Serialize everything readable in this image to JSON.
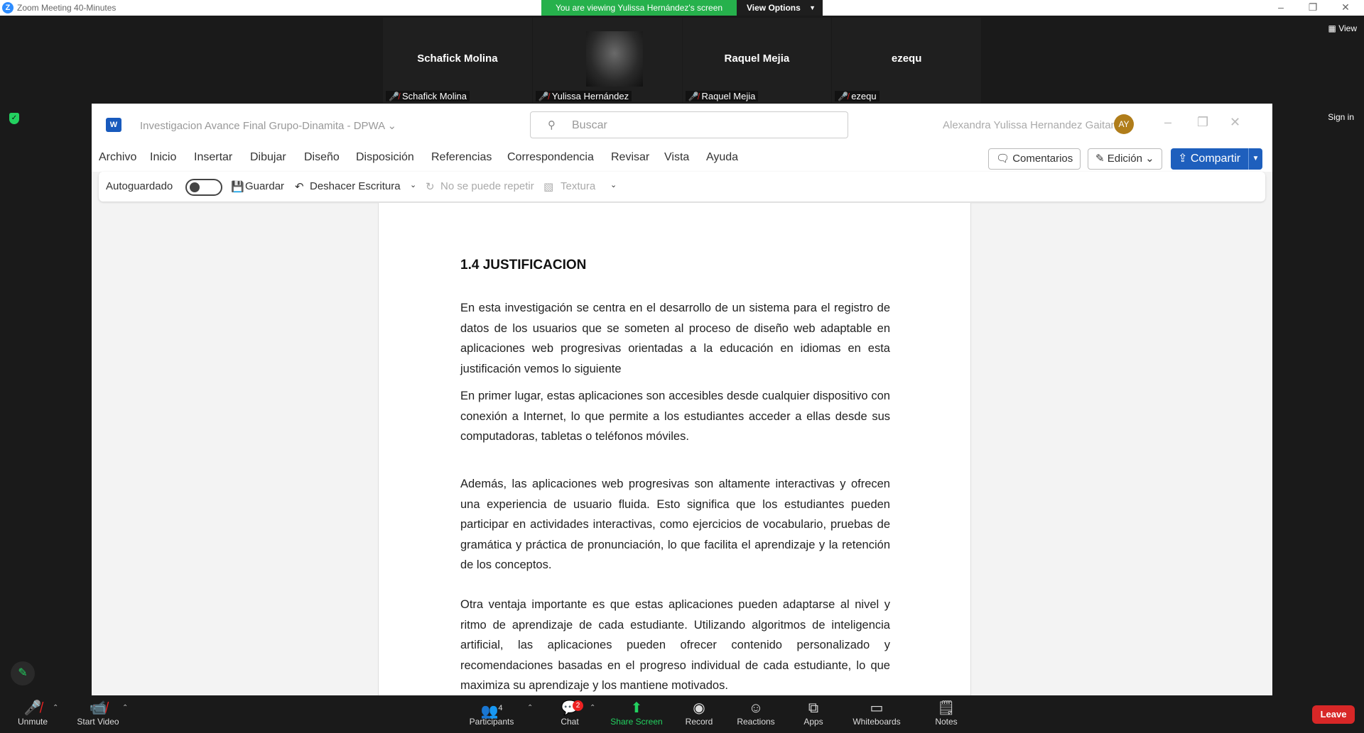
{
  "window": {
    "title": "Zoom Meeting 40-Minutes",
    "banner_text": "You are viewing Yulissa Hernández's screen",
    "view_options": "View Options"
  },
  "participants": [
    {
      "display": "Schafick Molina",
      "label": "Schafick Molina",
      "video": false
    },
    {
      "display": "",
      "label": "Yulissa Hernández",
      "video": true
    },
    {
      "display": "Raquel Mejia",
      "label": "Raquel Mejia",
      "video": false
    },
    {
      "display": "ezequ",
      "label": "ezequ",
      "video": false
    }
  ],
  "side": {
    "view": "View",
    "sign_in": "Sign in"
  },
  "word": {
    "doc_title": "Investigacion Avance Final Grupo-Dinamita - DPWA",
    "search_placeholder": "Buscar",
    "user_name": "Alexandra Yulissa  Hernandez Gaitan",
    "avatar_initials": "AY",
    "menu": [
      "Archivo",
      "Inicio",
      "Insertar",
      "Dibujar",
      "Diseño",
      "Disposición",
      "Referencias",
      "Correspondencia",
      "Revisar",
      "Vista",
      "Ayuda"
    ],
    "comments": "Comentarios",
    "editing": "Edición",
    "share": "Compartir",
    "quickbar": {
      "autosave": "Autoguardado",
      "save": "Guardar",
      "undo": "Deshacer Escritura",
      "redo": "No se puede repetir",
      "texture": "Textura"
    },
    "document": {
      "heading": "1.4 JUSTIFICACION",
      "paragraphs": [
        "En esta investigación se centra en el desarrollo de un sistema para el registro de datos de los usuarios que se someten al proceso de diseño web adaptable en aplicaciones web progresivas orientadas a la educación en idiomas en esta justificación vemos lo siguiente",
        "En primer lugar, estas aplicaciones son accesibles desde cualquier dispositivo con conexión a Internet, lo que permite a los estudiantes acceder a ellas desde sus computadoras, tabletas o teléfonos móviles.",
        "Además, las aplicaciones web progresivas son altamente interactivas y ofrecen una experiencia de usuario fluida. Esto significa que los estudiantes pueden participar en actividades interactivas, como ejercicios de vocabulario, pruebas de gramática y práctica de pronunciación, lo que facilita el aprendizaje y la retención de los conceptos.",
        "Otra ventaja importante es que estas aplicaciones pueden adaptarse al nivel y ritmo de aprendizaje de cada estudiante. Utilizando algoritmos de inteligencia artificial, las aplicaciones pueden ofrecer contenido personalizado y recomendaciones basadas en el progreso individual de cada estudiante, lo que maximiza su aprendizaje y los mantiene motivados."
      ]
    }
  },
  "toolbar": {
    "unmute": "Unmute",
    "start_video": "Start Video",
    "participants": "Participants",
    "participants_count": "4",
    "chat": "Chat",
    "chat_badge": "2",
    "share_screen": "Share Screen",
    "record": "Record",
    "reactions": "Reactions",
    "apps": "Apps",
    "whiteboards": "Whiteboards",
    "notes": "Notes",
    "leave": "Leave"
  },
  "colors": {
    "share_green": "#23d160",
    "leave_red": "#d82727",
    "word_blue": "#1e5fbd",
    "banner_green": "#26b14c"
  }
}
